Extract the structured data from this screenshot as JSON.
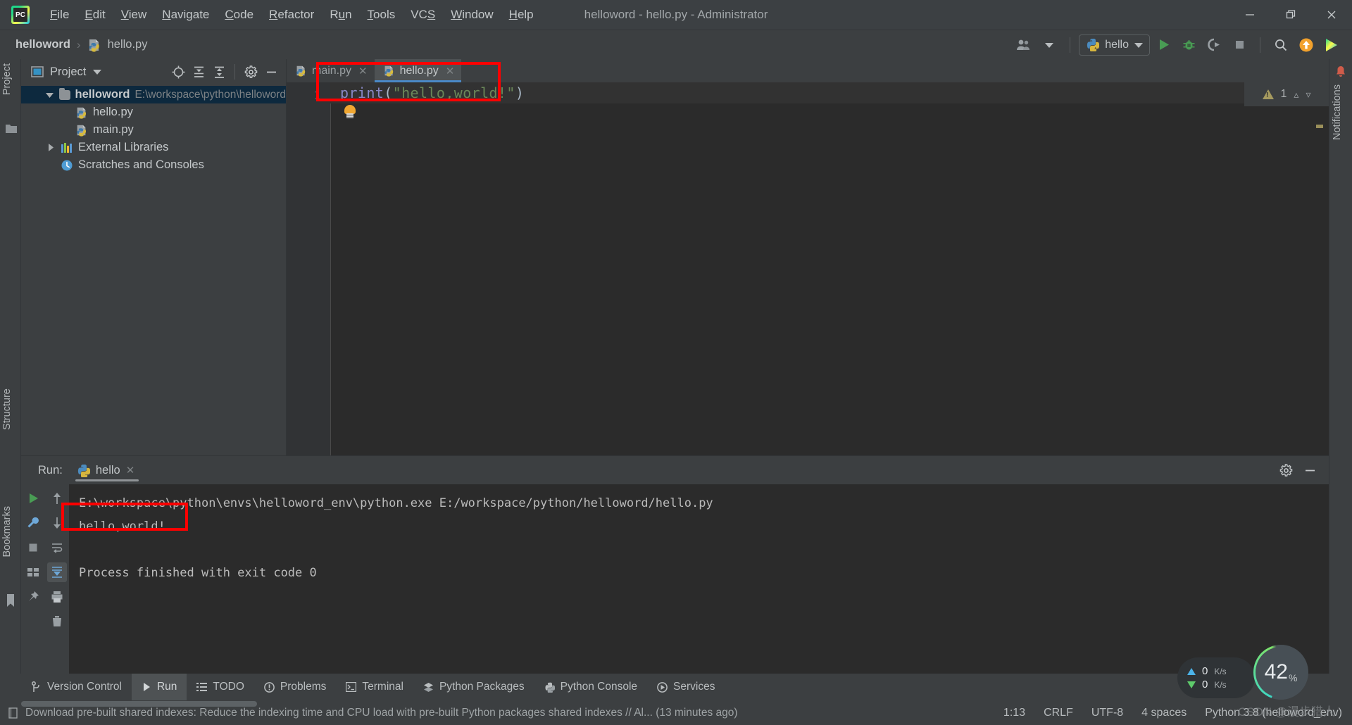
{
  "window": {
    "title": "helloword - hello.py - Administrator",
    "logo_label": "PC",
    "minimize": "minimize-icon",
    "maximize": "restore-icon",
    "close": "close-icon"
  },
  "menu": [
    {
      "label": "File",
      "mnemonic": "F"
    },
    {
      "label": "Edit",
      "mnemonic": "E"
    },
    {
      "label": "View",
      "mnemonic": "V"
    },
    {
      "label": "Navigate",
      "mnemonic": "N"
    },
    {
      "label": "Code",
      "mnemonic": "C"
    },
    {
      "label": "Refactor",
      "mnemonic": "R"
    },
    {
      "label": "Run",
      "mnemonic": "u"
    },
    {
      "label": "Tools",
      "mnemonic": "T"
    },
    {
      "label": "VCS",
      "mnemonic": "S"
    },
    {
      "label": "Window",
      "mnemonic": "W"
    },
    {
      "label": "Help",
      "mnemonic": "H"
    }
  ],
  "navbar": {
    "breadcrumb_project": "helloword",
    "breadcrumb_separator": "›",
    "breadcrumb_file": "hello.py",
    "run_configuration": "hello",
    "icons": {
      "account": "user-group-icon",
      "dropdown": "chevron-down-icon",
      "run": "run-icon",
      "debug": "debug-icon",
      "run_coverage": "run-with-coverage-icon",
      "stop": "stop-icon",
      "search": "search-icon",
      "update": "update-project-icon",
      "jetbrains": "jetbrains-toolbox-icon"
    }
  },
  "left_strip": {
    "project_tab": "Project",
    "structure_tab": "Structure",
    "bookmarks_tab": "Bookmarks"
  },
  "right_strip": {
    "notifications_tab": "Notifications"
  },
  "project_panel": {
    "title": "Project",
    "dropdown": "chevron-down-icon",
    "header_icons": [
      "locate-icon",
      "expand-all-icon",
      "collapse-all-icon",
      "settings-gear-icon",
      "hide-icon"
    ],
    "tree": [
      {
        "label": "helloword",
        "path": "E:\\workspace\\python\\helloword",
        "icon": "folder-icon",
        "depth": 0,
        "expanded": true,
        "selected": true,
        "bold": true
      },
      {
        "label": "hello.py",
        "path": "",
        "icon": "python-file-icon",
        "depth": 1,
        "expanded": null,
        "selected": false,
        "bold": false
      },
      {
        "label": "main.py",
        "path": "",
        "icon": "python-file-icon",
        "depth": 1,
        "expanded": null,
        "selected": false,
        "bold": false
      },
      {
        "label": "External Libraries",
        "path": "",
        "icon": "library-icon",
        "depth": 0,
        "expanded": false,
        "selected": false,
        "bold": false
      },
      {
        "label": "Scratches and Consoles",
        "path": "",
        "icon": "scratches-icon",
        "depth": 0,
        "expanded": null,
        "selected": false,
        "bold": false
      }
    ]
  },
  "editor": {
    "tabs": [
      {
        "label": "main.py",
        "icon": "python-file-icon",
        "active": false
      },
      {
        "label": "hello.py",
        "icon": "python-file-icon",
        "active": true
      }
    ],
    "line_number": "1",
    "code": {
      "func": "print",
      "open_paren": "(",
      "string": "\"hello,world!\"",
      "close_paren": ")"
    },
    "inspection_count": "1",
    "inspection_icon": "warning-triangle-icon",
    "prev_icon": "chevron-up-icon",
    "next_icon": "chevron-down-icon",
    "intention_bulb": "lightbulb-icon"
  },
  "run_panel": {
    "label": "Run:",
    "tab_name": "hello",
    "tab_icon": "python-icon",
    "tab_close": "close-icon",
    "settings_icon": "settings-gear-icon",
    "hide_icon": "hide-icon",
    "gutter_icons": [
      "rerun-icon",
      "up-arrow-icon",
      "down-arrow-icon",
      "wrench-icon",
      "stop-icon",
      "soft-wrap-icon",
      "scroll-to-end-icon",
      "print-icon",
      "clear-all-icon"
    ],
    "console_lines": [
      "E:\\workspace\\python\\envs\\helloword_env\\python.exe E:/workspace/python/helloword/hello.py",
      "hello,world!",
      "",
      "Process finished with exit code 0"
    ]
  },
  "bottom_bar": [
    {
      "label": "Version Control",
      "icon": "branch-icon",
      "active": false
    },
    {
      "label": "Run",
      "icon": "run-icon",
      "active": true
    },
    {
      "label": "TODO",
      "icon": "todo-list-icon",
      "active": false
    },
    {
      "label": "Problems",
      "icon": "problems-icon",
      "active": false
    },
    {
      "label": "Terminal",
      "icon": "terminal-icon",
      "active": false
    },
    {
      "label": "Python Packages",
      "icon": "packages-icon",
      "active": false
    },
    {
      "label": "Python Console",
      "icon": "python-console-icon",
      "active": false
    },
    {
      "label": "Services",
      "icon": "services-icon",
      "active": false
    }
  ],
  "status_bar": {
    "message_icon": "notification-icon",
    "message": "Download pre-built shared indexes: Reduce the indexing time and CPU load with pre-built Python packages shared indexes // Al... (13 minutes ago)",
    "caret_position": "1:13",
    "line_separator": "CRLF",
    "encoding": "UTF-8",
    "indent": "4 spaces",
    "interpreter": "Python 3.8 (helloword_env)"
  },
  "widgets": {
    "net_upload": "0",
    "net_upload_unit": "K/s",
    "net_download": "0",
    "net_download_unit": "K/s",
    "memory_value": "42",
    "memory_unit": "%"
  },
  "watermark": {
    "text": "CSDN @漫步猎人"
  },
  "colors": {
    "accent_blue": "#4a88c7",
    "run_green": "#499c54",
    "warning": "#a59a5f",
    "string_green": "#6a8759",
    "keyword_purple": "#8888c6",
    "annotation_red": "#ff0000",
    "panel_bg": "#3c3f41",
    "editor_bg": "#2b2b2b"
  }
}
